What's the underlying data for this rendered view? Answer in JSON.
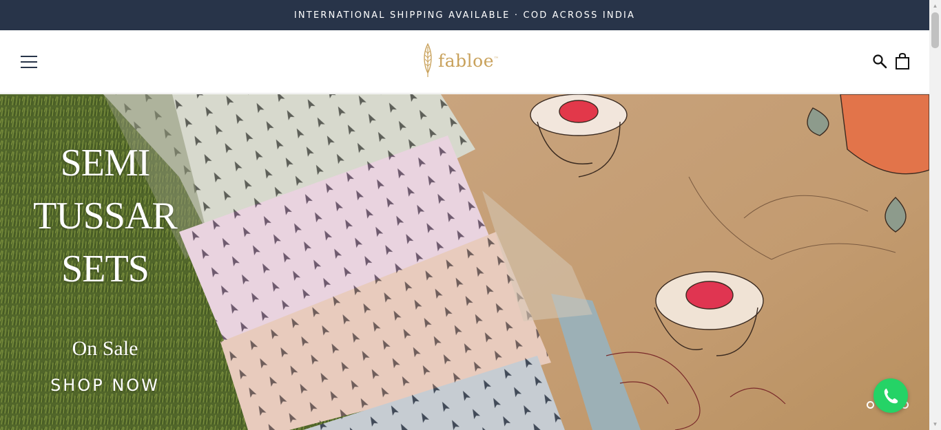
{
  "announcement": {
    "text": "INTERNATIONAL SHIPPING AVAILABLE · COD ACROSS INDIA"
  },
  "header": {
    "logo_text": "fabloe",
    "logo_tm": "™",
    "menu_icon": "hamburger-menu-icon",
    "search_icon": "search-icon",
    "cart_icon": "shopping-bag-icon"
  },
  "hero": {
    "title_line1": "SEMI",
    "title_line2": "TUSSAR",
    "title_line3": "SETS",
    "sale_text": "On Sale",
    "cta_text": "SHOP NOW",
    "slides": [
      {
        "active": false
      },
      {
        "active": true
      },
      {
        "active": false
      }
    ]
  },
  "whatsapp": {
    "icon": "whatsapp-icon"
  },
  "colors": {
    "announcement_bg": "#283449",
    "logo_gold": "#c9a25c",
    "whatsapp_green": "#25d366"
  }
}
